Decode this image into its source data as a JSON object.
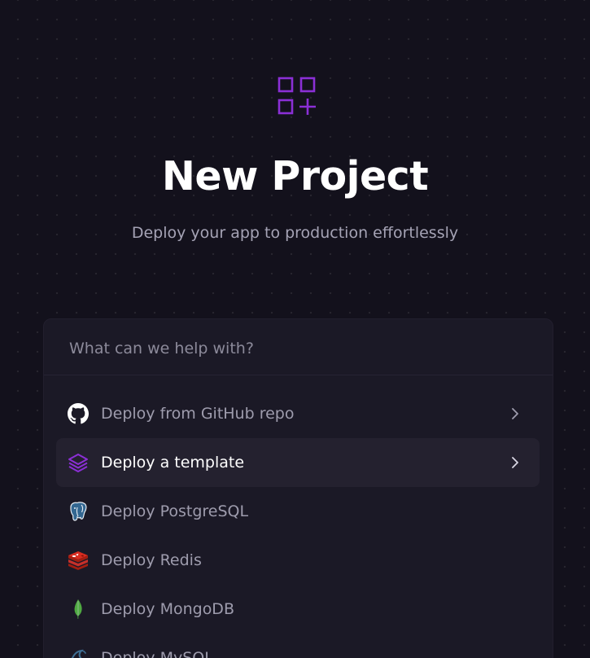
{
  "header": {
    "logo_icon": "apps-add-icon",
    "title": "New Project",
    "subtitle": "Deploy your app to production effortlessly"
  },
  "search": {
    "placeholder": "What can we help with?",
    "value": ""
  },
  "options": [
    {
      "label": "Deploy from GitHub repo",
      "icon": "github-icon",
      "chevron": true,
      "selected": false
    },
    {
      "label": "Deploy a template",
      "icon": "layers-icon",
      "chevron": true,
      "selected": true
    },
    {
      "label": "Deploy PostgreSQL",
      "icon": "postgresql-icon",
      "chevron": false,
      "selected": false
    },
    {
      "label": "Deploy Redis",
      "icon": "redis-icon",
      "chevron": false,
      "selected": false
    },
    {
      "label": "Deploy MongoDB",
      "icon": "mongodb-icon",
      "chevron": false,
      "selected": false
    },
    {
      "label": "Deploy MySQL",
      "icon": "mysql-icon",
      "chevron": false,
      "selected": false
    }
  ],
  "colors": {
    "background": "#13111c",
    "card": "#1b1926",
    "accent": "#8b2fd6",
    "selected_row": "#24212f"
  }
}
